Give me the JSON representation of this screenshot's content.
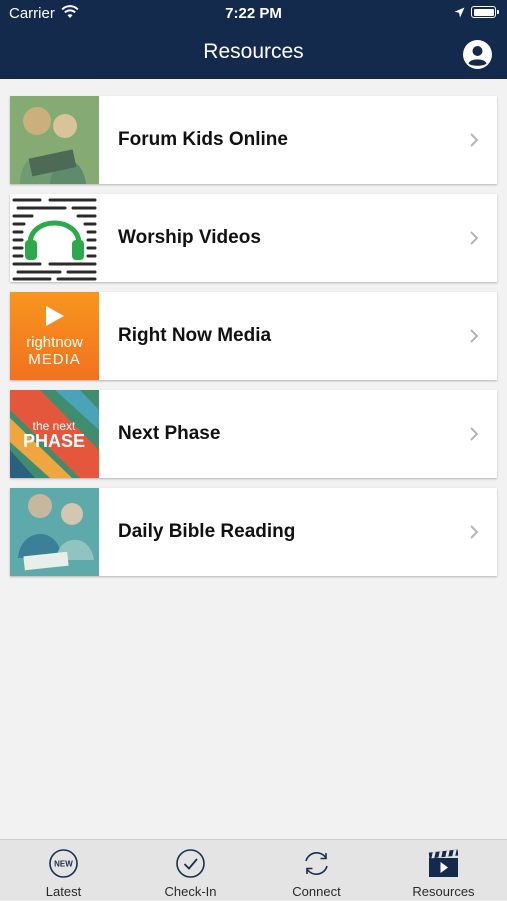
{
  "status": {
    "carrier": "Carrier",
    "time": "7:22 PM"
  },
  "header": {
    "title": "Resources",
    "profile_icon": "person-circle-icon"
  },
  "colors": {
    "nav": "#132a4c",
    "background": "#f2f2f2",
    "tabbar": "#e4e4e4",
    "rightnow_orange": "#f5821f"
  },
  "items": [
    {
      "label": "Forum Kids Online",
      "thumbnail": "kids-reading-photo"
    },
    {
      "label": "Worship Videos",
      "thumbnail": "headphones-graphic"
    },
    {
      "label": "Right Now Media",
      "thumbnail": "rightnow-media-logo",
      "logo_text_top": "rightnow",
      "logo_text_bottom": "MEDIA"
    },
    {
      "label": "Next Phase",
      "thumbnail": "next-phase-graphic",
      "logo_text_top": "the next",
      "logo_text_bottom": "PHASE"
    },
    {
      "label": "Daily Bible Reading",
      "thumbnail": "children-reading-photo"
    }
  ],
  "tabs": [
    {
      "label": "Latest",
      "icon": "new-badge-icon",
      "badge_text": "NEW"
    },
    {
      "label": "Check-In",
      "icon": "checkmark-circle-icon"
    },
    {
      "label": "Connect",
      "icon": "sync-arrows-icon"
    },
    {
      "label": "Resources",
      "icon": "clapperboard-icon",
      "selected": true
    }
  ]
}
